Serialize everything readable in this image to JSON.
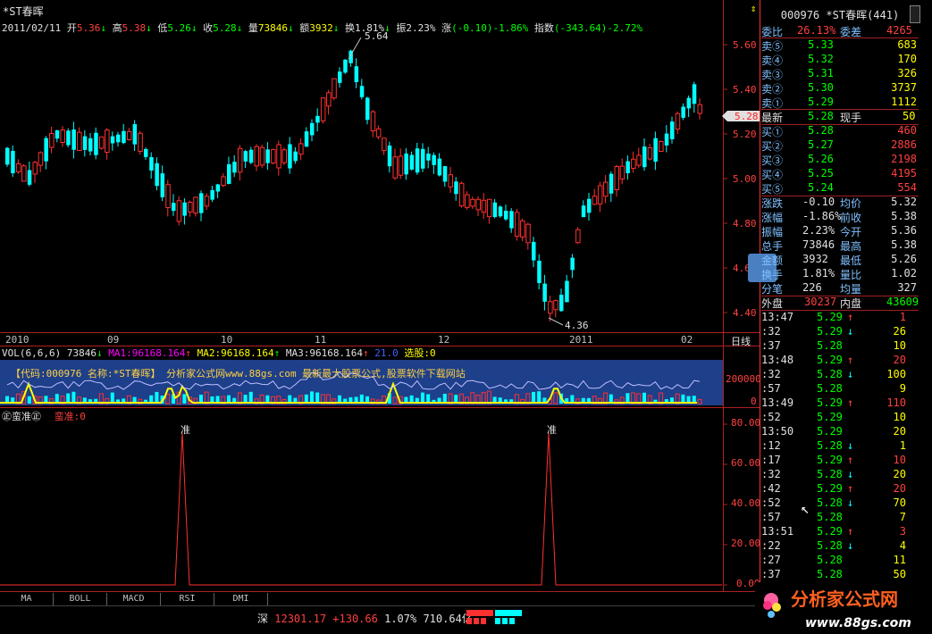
{
  "window": {
    "title": "*ST春晖",
    "corner_icon": "⇕"
  },
  "info_bar": {
    "date": "2011/02/11",
    "open_label": "开",
    "open": "5.36",
    "high_label": "高",
    "high": "5.38",
    "low_label": "低",
    "low": "5.26",
    "close_label": "收",
    "close": "5.28",
    "vol_label": "量",
    "vol": "73846",
    "amount_label": "额",
    "amount": "3932",
    "turnover_label": "换",
    "turnover": "1.81%",
    "amplitude_label": "振",
    "amplitude": "2.23%",
    "change_label": "涨",
    "change": "(-0.10)-1.86%",
    "index_label": "指数",
    "index": "(-343.64)-2.72%"
  },
  "price_axis": [
    "5.60",
    "5.40",
    "5.20",
    "5.00",
    "4.80",
    "4.60",
    "4.40"
  ],
  "price_tag": "5.28",
  "annotations": {
    "high": "5.64",
    "low": "4.36"
  },
  "time_axis": [
    "2010",
    "09",
    "10",
    "11",
    "12",
    "2011",
    "02"
  ],
  "period_label": "日线",
  "vol_legend": {
    "name": "VOL(6,6,6)",
    "val": "73846",
    "ma1": "MA1:96168.164",
    "ma2": "MA2:96168.164",
    "ma3": "MA3:96168.164",
    "extra": "21.0",
    "select": "选股:0"
  },
  "vol_axis": [
    "200000",
    "0"
  ],
  "vol_banner": "【代码:000976 名称:*ST春晖】      分析家公式网www.88gs.com  最新最大股票公式,股票软件下载网站",
  "indicator": {
    "name": "蛮准",
    "value_label": "蛮准:0",
    "peak_label": "准"
  },
  "ind_axis": [
    "80.00",
    "60.00",
    "40.00",
    "20.00",
    "0.00"
  ],
  "tabs": [
    "MA",
    "BOLL",
    "MACD",
    "RSI",
    "DMI"
  ],
  "status": {
    "market": "深",
    "index": "12301.17",
    "change": "+130.66",
    "pct": "1.07%",
    "amount": "710.64亿"
  },
  "quote": {
    "code": "000976",
    "name": "*ST春晖",
    "rank": "(441)",
    "weibi_label": "委比",
    "weibi": "26.13%",
    "weicha_label": "委差",
    "weicha": "4265",
    "asks": [
      {
        "label": "卖⑤",
        "price": "5.33",
        "vol": "683"
      },
      {
        "label": "卖④",
        "price": "5.32",
        "vol": "170"
      },
      {
        "label": "卖③",
        "price": "5.31",
        "vol": "326"
      },
      {
        "label": "卖②",
        "price": "5.30",
        "vol": "3737"
      },
      {
        "label": "卖①",
        "price": "5.29",
        "vol": "1112"
      }
    ],
    "last_label": "最新",
    "last": "5.28",
    "xianshou_label": "现手",
    "xianshou": "50",
    "bids": [
      {
        "label": "买①",
        "price": "5.28",
        "vol": "460"
      },
      {
        "label": "买②",
        "price": "5.27",
        "vol": "2886"
      },
      {
        "label": "买③",
        "price": "5.26",
        "vol": "2198"
      },
      {
        "label": "买④",
        "price": "5.25",
        "vol": "4195"
      },
      {
        "label": "买⑤",
        "price": "5.24",
        "vol": "554"
      }
    ],
    "stats": [
      {
        "l1": "涨跌",
        "v1": "-0.10",
        "l2": "均价",
        "v2": "5.32"
      },
      {
        "l1": "涨幅",
        "v1": "-1.86%",
        "l2": "前收",
        "v2": "5.38"
      },
      {
        "l1": "振幅",
        "v1": "2.23%",
        "l2": "今开",
        "v2": "5.36"
      },
      {
        "l1": "总手",
        "v1": "73846",
        "l2": "最高",
        "v2": "5.38"
      },
      {
        "l1": "金额",
        "v1": "3932",
        "l2": "最低",
        "v2": "5.26"
      },
      {
        "l1": "换手",
        "v1": "1.81%",
        "l2": "量比",
        "v2": "1.02"
      },
      {
        "l1": "分笔",
        "v1": "226",
        "l2": "均量",
        "v2": "327"
      }
    ],
    "waipan_label": "外盘",
    "waipan": "30237",
    "neipan_label": "内盘",
    "neipan": "43609"
  },
  "ticks": [
    {
      "t": "13:47",
      "p": "5.29",
      "d": "↑",
      "v": "1"
    },
    {
      "t": ":32",
      "p": "5.29",
      "d": "↓",
      "v": "26"
    },
    {
      "t": ":37",
      "p": "5.28",
      "d": "",
      "v": "10"
    },
    {
      "t": "13:48",
      "p": "5.29",
      "d": "↑",
      "v": "20"
    },
    {
      "t": ":32",
      "p": "5.28",
      "d": "↓",
      "v": "100"
    },
    {
      "t": ":57",
      "p": "5.28",
      "d": "",
      "v": "9"
    },
    {
      "t": "13:49",
      "p": "5.29",
      "d": "↑",
      "v": "110"
    },
    {
      "t": ":52",
      "p": "5.29",
      "d": "",
      "v": "10"
    },
    {
      "t": "13:50",
      "p": "5.29",
      "d": "",
      "v": "20"
    },
    {
      "t": ":12",
      "p": "5.28",
      "d": "↓",
      "v": "1"
    },
    {
      "t": ":17",
      "p": "5.29",
      "d": "↑",
      "v": "10"
    },
    {
      "t": ":32",
      "p": "5.28",
      "d": "↓",
      "v": "20"
    },
    {
      "t": ":42",
      "p": "5.29",
      "d": "↑",
      "v": "20"
    },
    {
      "t": ":52",
      "p": "5.28",
      "d": "↓",
      "v": "70"
    },
    {
      "t": ":57",
      "p": "5.28",
      "d": "",
      "v": "7"
    },
    {
      "t": "13:51",
      "p": "5.29",
      "d": "↑",
      "v": "3"
    },
    {
      "t": ":22",
      "p": "5.28",
      "d": "↓",
      "v": "4"
    },
    {
      "t": ":27",
      "p": "5.28",
      "d": "",
      "v": "11"
    },
    {
      "t": ":37",
      "p": "5.28",
      "d": "",
      "v": "50"
    }
  ],
  "watermark": {
    "cn": "分析家公式网",
    "url": "www.88gs.com"
  },
  "colors": {
    "up": "#ff3030",
    "down": "#00ffff",
    "bg": "#000000",
    "vol_line": "#ffff00",
    "accent": "#1e3f8a"
  }
}
